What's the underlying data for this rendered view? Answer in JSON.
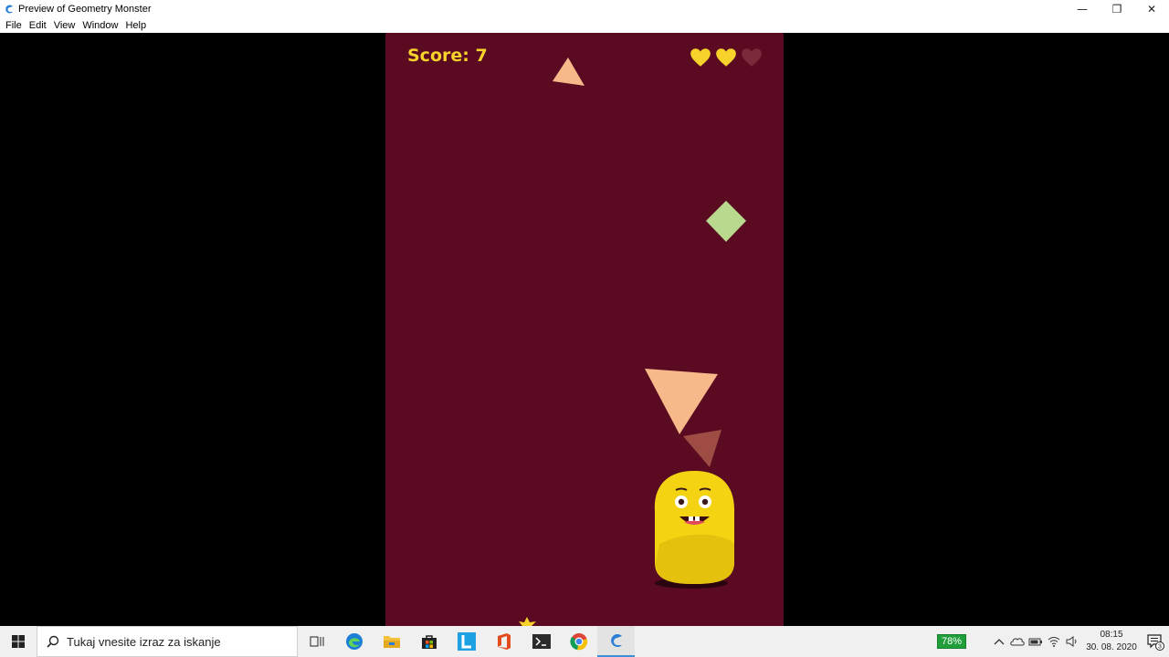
{
  "window": {
    "title": "Preview of Geometry Monster",
    "controls": [
      "—",
      "❐",
      "✕"
    ]
  },
  "menu": {
    "items": [
      "File",
      "Edit",
      "View",
      "Window",
      "Help"
    ]
  },
  "game": {
    "score_text": "Score: 7",
    "lives_total": 3,
    "lives_remaining": 2,
    "background": "#5a0b22",
    "heart_color": "#f6d22a",
    "heart_empty_color": "#7a2a3a"
  },
  "taskbar": {
    "search_placeholder": "Tukaj vnesite izraz za iskanje",
    "pinned": [
      "task-view-icon",
      "edge-icon",
      "file-explorer-icon",
      "store-icon",
      "l-app-icon",
      "office-icon",
      "terminal-icon",
      "chrome-icon",
      "geometry-preview-icon"
    ],
    "battery": "78%",
    "time": "08:15",
    "date": "30. 08. 2020",
    "notification_count": "3"
  }
}
